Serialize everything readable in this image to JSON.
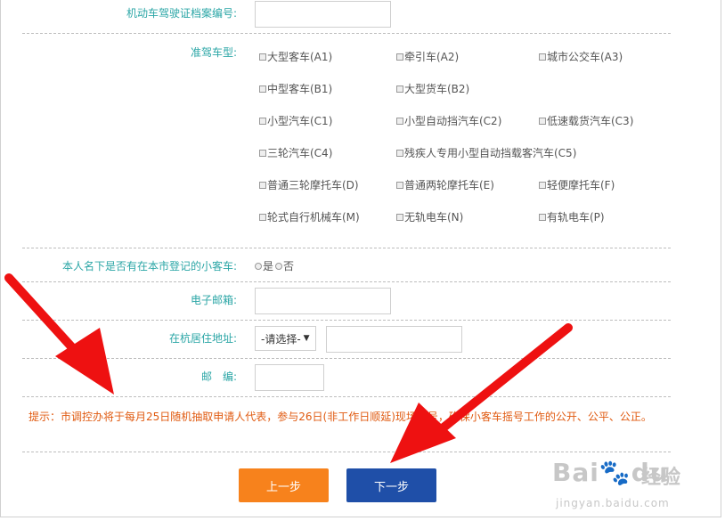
{
  "form": {
    "file_no_label": "机动车驾驶证档案编号:",
    "file_no_value": "",
    "vehicle_type_label": "准驾车型:",
    "vehicle_types": [
      "大型客车(A1)",
      "牵引车(A2)",
      "城市公交车(A3)",
      "中型客车(B1)",
      "大型货车(B2)",
      "小型汽车(C1)",
      "小型自动挡汽车(C2)",
      "低速载货汽车(C3)",
      "三轮汽车(C4)",
      "残疾人专用小型自动挡载客汽车(C5)",
      "普通三轮摩托车(D)",
      "普通两轮摩托车(E)",
      "轻便摩托车(F)",
      "轮式自行机械车(M)",
      "无轨电车(N)",
      "有轨电车(P)"
    ],
    "car_registered_label": "本人名下是否有在本市登记的小客车:",
    "car_registered_yes": "是",
    "car_registered_no": "否",
    "email_label": "电子邮箱:",
    "email_value": "",
    "address_label": "在杭居住地址:",
    "address_select": "-请选择-",
    "address_value": "",
    "postcode_label": "邮　编:",
    "postcode_value": ""
  },
  "tip": "提示：市调控办将于每月25日随机抽取申请人代表，参与26日(非工作日顺延)现场摇号，确保小客车摇号工作的公开、公平、公正。",
  "buttons": {
    "prev": "上一步",
    "next": "下一步"
  },
  "watermark": {
    "logo": "Bai",
    "logo_tail": "du",
    "cn": "经验",
    "url": "jingyan.baidu.com"
  },
  "colors": {
    "label": "#2ba6a6",
    "tip": "#e05a10",
    "prev_button": "#f7821c",
    "next_button": "#1f4fa8",
    "arrow": "#ee1111"
  }
}
